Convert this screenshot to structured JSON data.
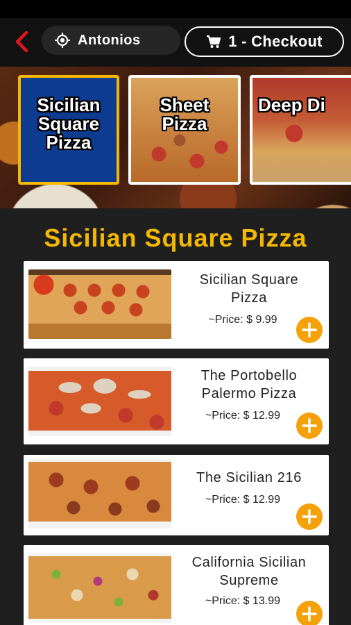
{
  "header": {
    "location": "Antonios",
    "checkout": "1 - Checkout"
  },
  "categories": [
    {
      "label_lines": [
        "Sicilian",
        "Square",
        "Pizza"
      ],
      "selected": true
    },
    {
      "label_lines": [
        "Sheet",
        "Pizza"
      ],
      "selected": false
    },
    {
      "label_lines": [
        "Deep Di"
      ],
      "selected": false
    }
  ],
  "section": {
    "title": "Sicilian Square Pizza"
  },
  "items": [
    {
      "name_lines": [
        "Sicilian Square",
        "Pizza"
      ],
      "price": "~Price: $ 9.99"
    },
    {
      "name_lines": [
        "The Portobello",
        "Palermo Pizza"
      ],
      "price": "~Price: $ 12.99"
    },
    {
      "name_lines": [
        "The Sicilian 216"
      ],
      "price": "~Price: $ 12.99"
    },
    {
      "name_lines": [
        "California Sicilian",
        "Supreme"
      ],
      "price": "~Price: $ 13.99"
    }
  ],
  "colors": {
    "accent": "#f5b800",
    "add_button": "#f5a10a",
    "selected_tile": "#0d3b8f",
    "back_arrow": "#e0161d"
  }
}
